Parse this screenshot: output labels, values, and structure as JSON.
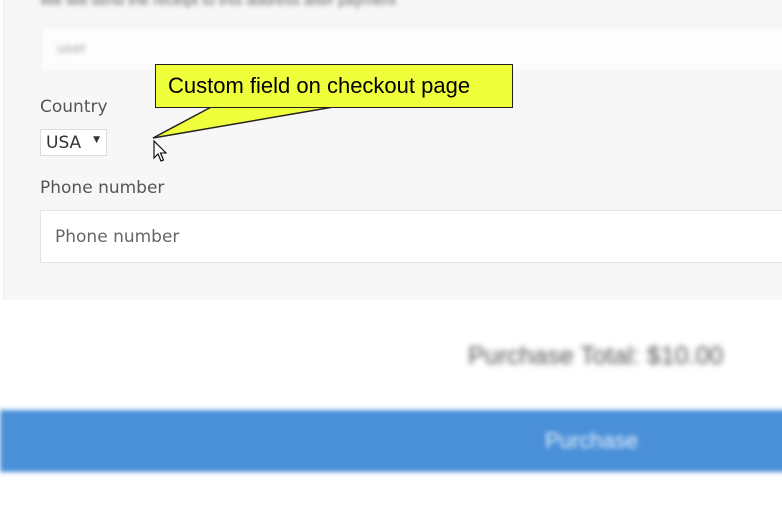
{
  "form": {
    "top_hint_text": "We will send the receipt to this address after payment",
    "top_input_value": "user",
    "country_label": "Country",
    "country_selected": "USA",
    "country_arrow": "▼",
    "phone_label": "Phone number",
    "phone_placeholder": "Phone number"
  },
  "callout": {
    "text": "Custom field on checkout page",
    "color": "#f0ff3c"
  },
  "checkout": {
    "total_text": "Purchase Total: $10.00",
    "purchase_label": "Purchase",
    "button_color": "#4a90d9"
  },
  "icons": {
    "cursor": "mouse-pointer-icon",
    "dropdown": "dropdown-arrow-icon"
  }
}
